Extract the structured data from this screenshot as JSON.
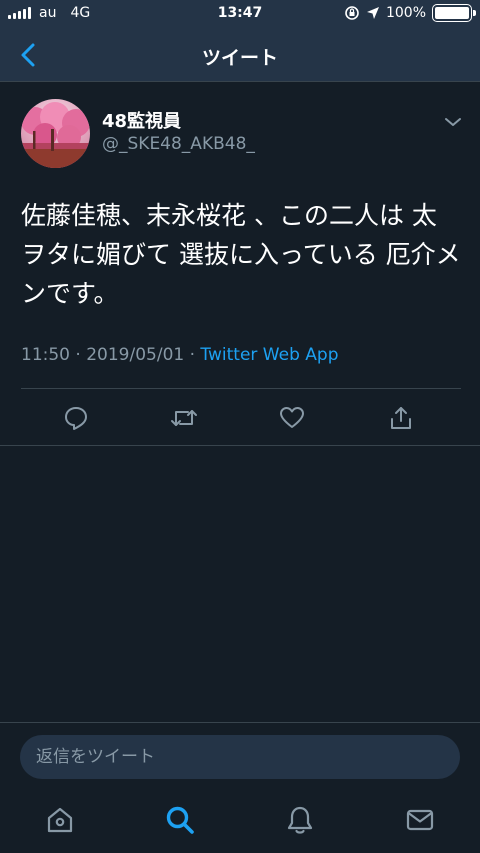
{
  "status_bar": {
    "carrier": "au",
    "network": "4G",
    "time": "13:47",
    "battery": "100%",
    "battery_level": 1.0
  },
  "nav": {
    "title": "ツイート",
    "back_icon": "chevron-left-icon"
  },
  "tweet": {
    "display_name": "48監視員",
    "handle": "@_SKE48_AKB48_",
    "text": "佐藤佳穂、末永桜花 、この二人は 太ヲタに媚びて 選抜に入っている 厄介メンです。",
    "time": "11:50",
    "date": "2019/05/01",
    "source": "Twitter Web App",
    "separator": " · "
  },
  "actions": [
    "reply-icon",
    "retweet-icon",
    "like-icon",
    "share-icon"
  ],
  "reply": {
    "placeholder": "返信をツイート"
  },
  "tabs": [
    "home-icon",
    "search-icon",
    "notifications-icon",
    "messages-icon"
  ],
  "colors": {
    "background": "#141d26",
    "header": "#243447",
    "accent": "#1da1f2",
    "secondary_text": "#8899a6",
    "divider": "#38444d"
  }
}
